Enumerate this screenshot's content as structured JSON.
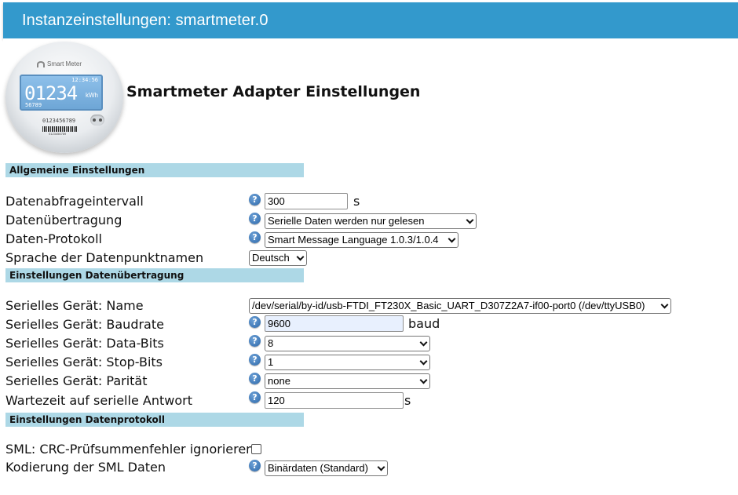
{
  "window": {
    "title": "Instanzeinstellungen: smartmeter.0"
  },
  "logo": {
    "brand": "Smart Meter",
    "time": "12:34:56",
    "reading": "01234",
    "unit": "kWh",
    "sub": "56789",
    "serial": "0123456789",
    "barcode_number": "0123456789"
  },
  "heading": "Smartmeter Adapter Einstellungen",
  "sections": {
    "general": "Allgemeine Einstellungen",
    "transfer": "Einstellungen Datenübertragung",
    "protocol": "Einstellungen Datenprotokoll"
  },
  "fields": {
    "interval": {
      "label": "Datenabfrageintervall",
      "value": "300",
      "unit": "s"
    },
    "transfer": {
      "label": "Datenübertragung",
      "value": "Serielle Daten werden nur gelesen"
    },
    "protocol": {
      "label": "Daten-Protokoll",
      "value": "Smart Message Language 1.0.3/1.0.4"
    },
    "language": {
      "label": "Sprache der Datenpunktnamen",
      "value": "Deutsch"
    },
    "serial_name": {
      "label": "Serielles Gerät: Name",
      "value": "/dev/serial/by-id/usb-FTDI_FT230X_Basic_UART_D307Z2A7-if00-port0 (/dev/ttyUSB0)"
    },
    "baudrate": {
      "label": "Serielles Gerät: Baudrate",
      "value": "9600",
      "unit": "baud"
    },
    "databits": {
      "label": "Serielles Gerät: Data-Bits",
      "value": "8"
    },
    "stopbits": {
      "label": "Serielles Gerät: Stop-Bits",
      "value": "1"
    },
    "parity": {
      "label": "Serielles Gerät: Parität",
      "value": "none"
    },
    "wait": {
      "label": "Wartezeit auf serielle Antwort",
      "value": "120",
      "unit": "s"
    },
    "crc": {
      "label": "SML: CRC-Prüfsummenfehler ignorieren",
      "checked": false
    },
    "encoding": {
      "label": "Kodierung der SML Daten",
      "value": "Binärdaten (Standard)"
    }
  },
  "icons": {
    "help": "?"
  },
  "colors": {
    "titlebar": "#3399cc",
    "section": "#add8e6",
    "help": "#2b66a8"
  }
}
